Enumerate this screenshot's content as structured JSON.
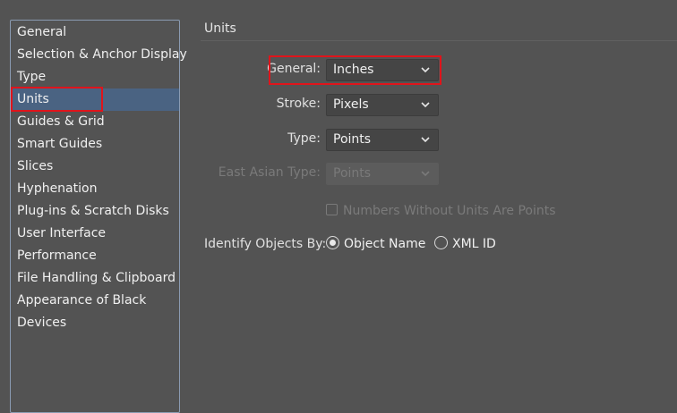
{
  "sidebar": {
    "items": [
      {
        "label": "General"
      },
      {
        "label": "Selection & Anchor Display"
      },
      {
        "label": "Type"
      },
      {
        "label": "Units"
      },
      {
        "label": "Guides & Grid"
      },
      {
        "label": "Smart Guides"
      },
      {
        "label": "Slices"
      },
      {
        "label": "Hyphenation"
      },
      {
        "label": "Plug-ins & Scratch Disks"
      },
      {
        "label": "User Interface"
      },
      {
        "label": "Performance"
      },
      {
        "label": "File Handling & Clipboard"
      },
      {
        "label": "Appearance of Black"
      },
      {
        "label": "Devices"
      }
    ],
    "selected": "Units"
  },
  "panel": {
    "title": "Units",
    "general": {
      "label": "General:",
      "value": "Inches"
    },
    "stroke": {
      "label": "Stroke:",
      "value": "Pixels"
    },
    "type": {
      "label": "Type:",
      "value": "Points"
    },
    "east_asian_type": {
      "label": "East Asian Type:",
      "value": "Points",
      "enabled": false
    },
    "numbers_without_units": {
      "label": "Numbers Without Units Are Points",
      "checked": false,
      "enabled": false
    },
    "identify_objects": {
      "label": "Identify Objects By:",
      "options": [
        {
          "label": "Object Name",
          "checked": true
        },
        {
          "label": "XML ID",
          "checked": false
        }
      ]
    }
  },
  "colors": {
    "background": "#535353",
    "selection": "#4a6382",
    "highlight": "#e0141b"
  }
}
